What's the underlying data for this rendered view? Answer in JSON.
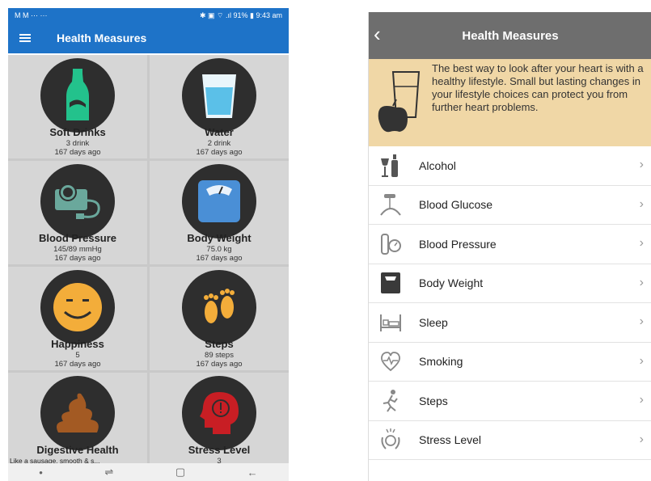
{
  "left": {
    "status_left": "M M ⋯ ···",
    "status_right": "✱ ▣ ⌔ .ıl 91% ▮ 9:43 am",
    "title": "Health Measures",
    "tiles": [
      {
        "title": "Soft Drinks",
        "value": "3 drink",
        "ago": "167 days ago",
        "icon": "soft-drink-bottle-icon"
      },
      {
        "title": "Water",
        "value": "2 drink",
        "ago": "167 days ago",
        "icon": "water-glass-icon"
      },
      {
        "title": "Blood Pressure",
        "value": "145/89 mmHg",
        "ago": "167 days ago",
        "icon": "blood-pressure-monitor-icon"
      },
      {
        "title": "Body Weight",
        "value": "75.0 kg",
        "ago": "167 days ago",
        "icon": "scale-icon"
      },
      {
        "title": "Happiness",
        "value": "5",
        "ago": "167 days ago",
        "icon": "smiley-face-icon"
      },
      {
        "title": "Steps",
        "value": "89 steps",
        "ago": "167 days ago",
        "icon": "footprints-icon"
      },
      {
        "title": "Digestive Health",
        "desc": "Like a sausage, smooth & s...",
        "icon": "poop-icon"
      },
      {
        "title": "Stress Level",
        "value": "3",
        "icon": "stressed-head-icon"
      }
    ],
    "nav": {
      "dot": "•",
      "recent": "⇌",
      "home": "▢",
      "back": "←"
    }
  },
  "right": {
    "back_glyph": "‹",
    "title": "Health Measures",
    "banner_text": "The best way to look after your heart is with a healthy lifestyle. Small but lasting changes in your lifestyle choices can protect you from further heart problems.",
    "items": [
      {
        "label": "Alcohol",
        "icon": "wine-bottle-glass-icon"
      },
      {
        "label": "Blood Glucose",
        "icon": "glucose-meter-icon"
      },
      {
        "label": "Blood Pressure",
        "icon": "blood-pressure-cuff-icon"
      },
      {
        "label": "Body Weight",
        "icon": "scale-icon"
      },
      {
        "label": "Sleep",
        "icon": "bed-icon"
      },
      {
        "label": "Smoking",
        "icon": "heart-pulse-icon"
      },
      {
        "label": "Steps",
        "icon": "running-person-icon"
      },
      {
        "label": "Stress Level",
        "icon": "stressed-hands-head-icon"
      }
    ],
    "chevron": "›"
  },
  "colors": {
    "left_appbar": "#1e73c8",
    "right_header": "#6e6e6e",
    "banner": "#f0d7a6",
    "tile_bg": "#d6d6d6",
    "icon_circle": "#2e2e2e"
  }
}
